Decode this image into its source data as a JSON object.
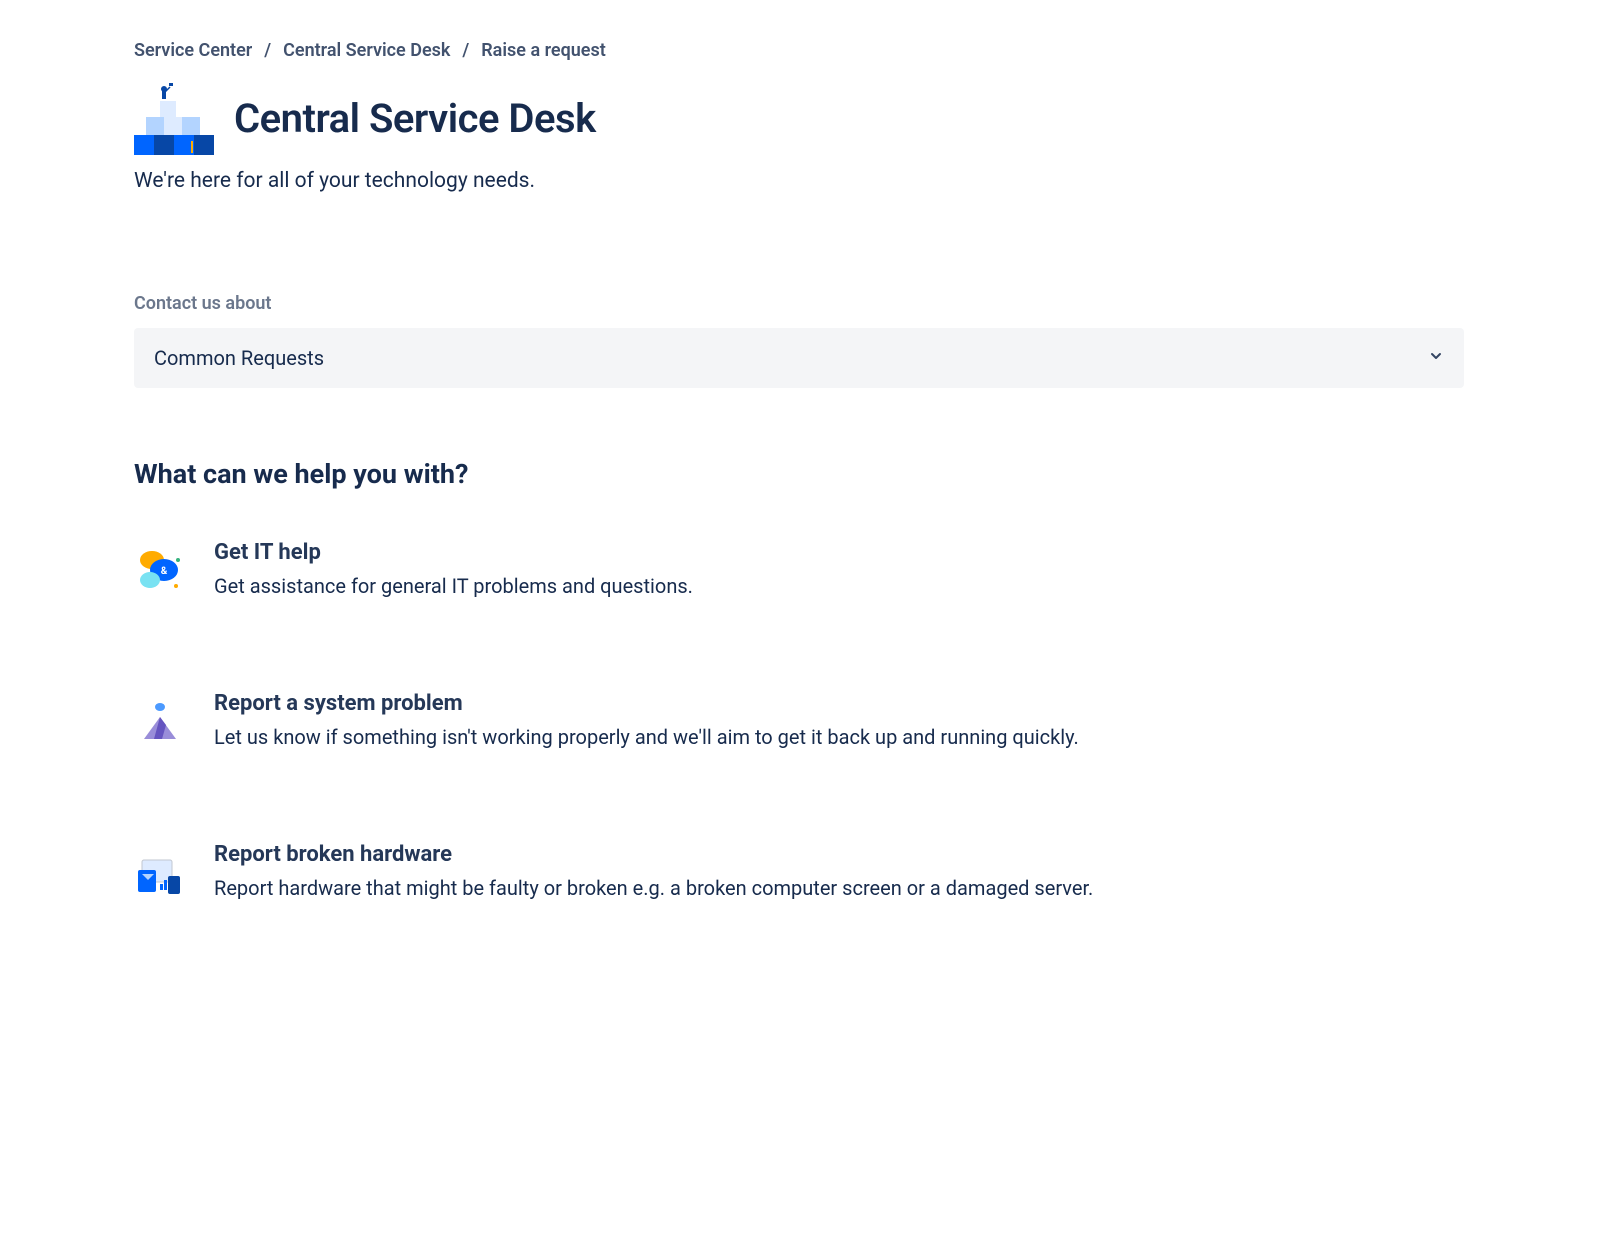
{
  "breadcrumb": {
    "items": [
      {
        "label": "Service Center"
      },
      {
        "label": "Central Service Desk"
      },
      {
        "label": "Raise a request"
      }
    ]
  },
  "header": {
    "title": "Central Service Desk",
    "subtitle": "We're here for all of your technology needs."
  },
  "contact": {
    "label": "Contact us about",
    "selected": "Common Requests"
  },
  "help": {
    "heading": "What can we help you with?"
  },
  "requests": [
    {
      "title": "Get IT help",
      "desc": "Get assistance for general IT problems and questions."
    },
    {
      "title": "Report a system problem",
      "desc": "Let us know if something isn't working properly and we'll aim to get it back up and running quickly."
    },
    {
      "title": "Report broken hardware",
      "desc": "Report hardware that might be faulty or broken e.g. a broken computer screen or a damaged server."
    }
  ]
}
